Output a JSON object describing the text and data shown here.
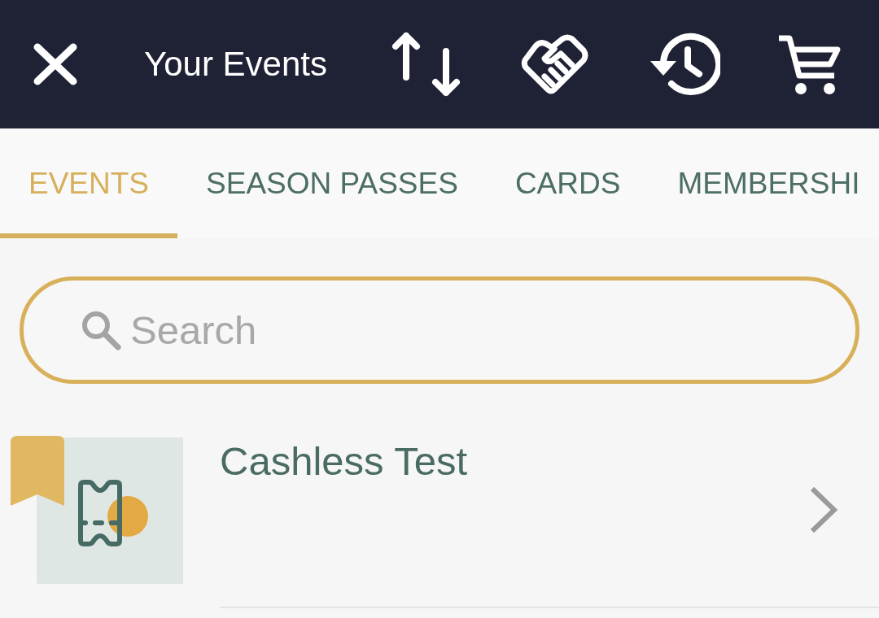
{
  "header": {
    "title": "Your Events"
  },
  "tabs": [
    {
      "label": "EVENTS",
      "selected": true
    },
    {
      "label": "SEASON PASSES",
      "selected": false
    },
    {
      "label": "CARDS",
      "selected": false
    },
    {
      "label": "MEMBERSHI",
      "selected": false
    }
  ],
  "search": {
    "placeholder": "Search"
  },
  "events": [
    {
      "title": "Cashless Test",
      "bookmarked": true
    }
  ]
}
